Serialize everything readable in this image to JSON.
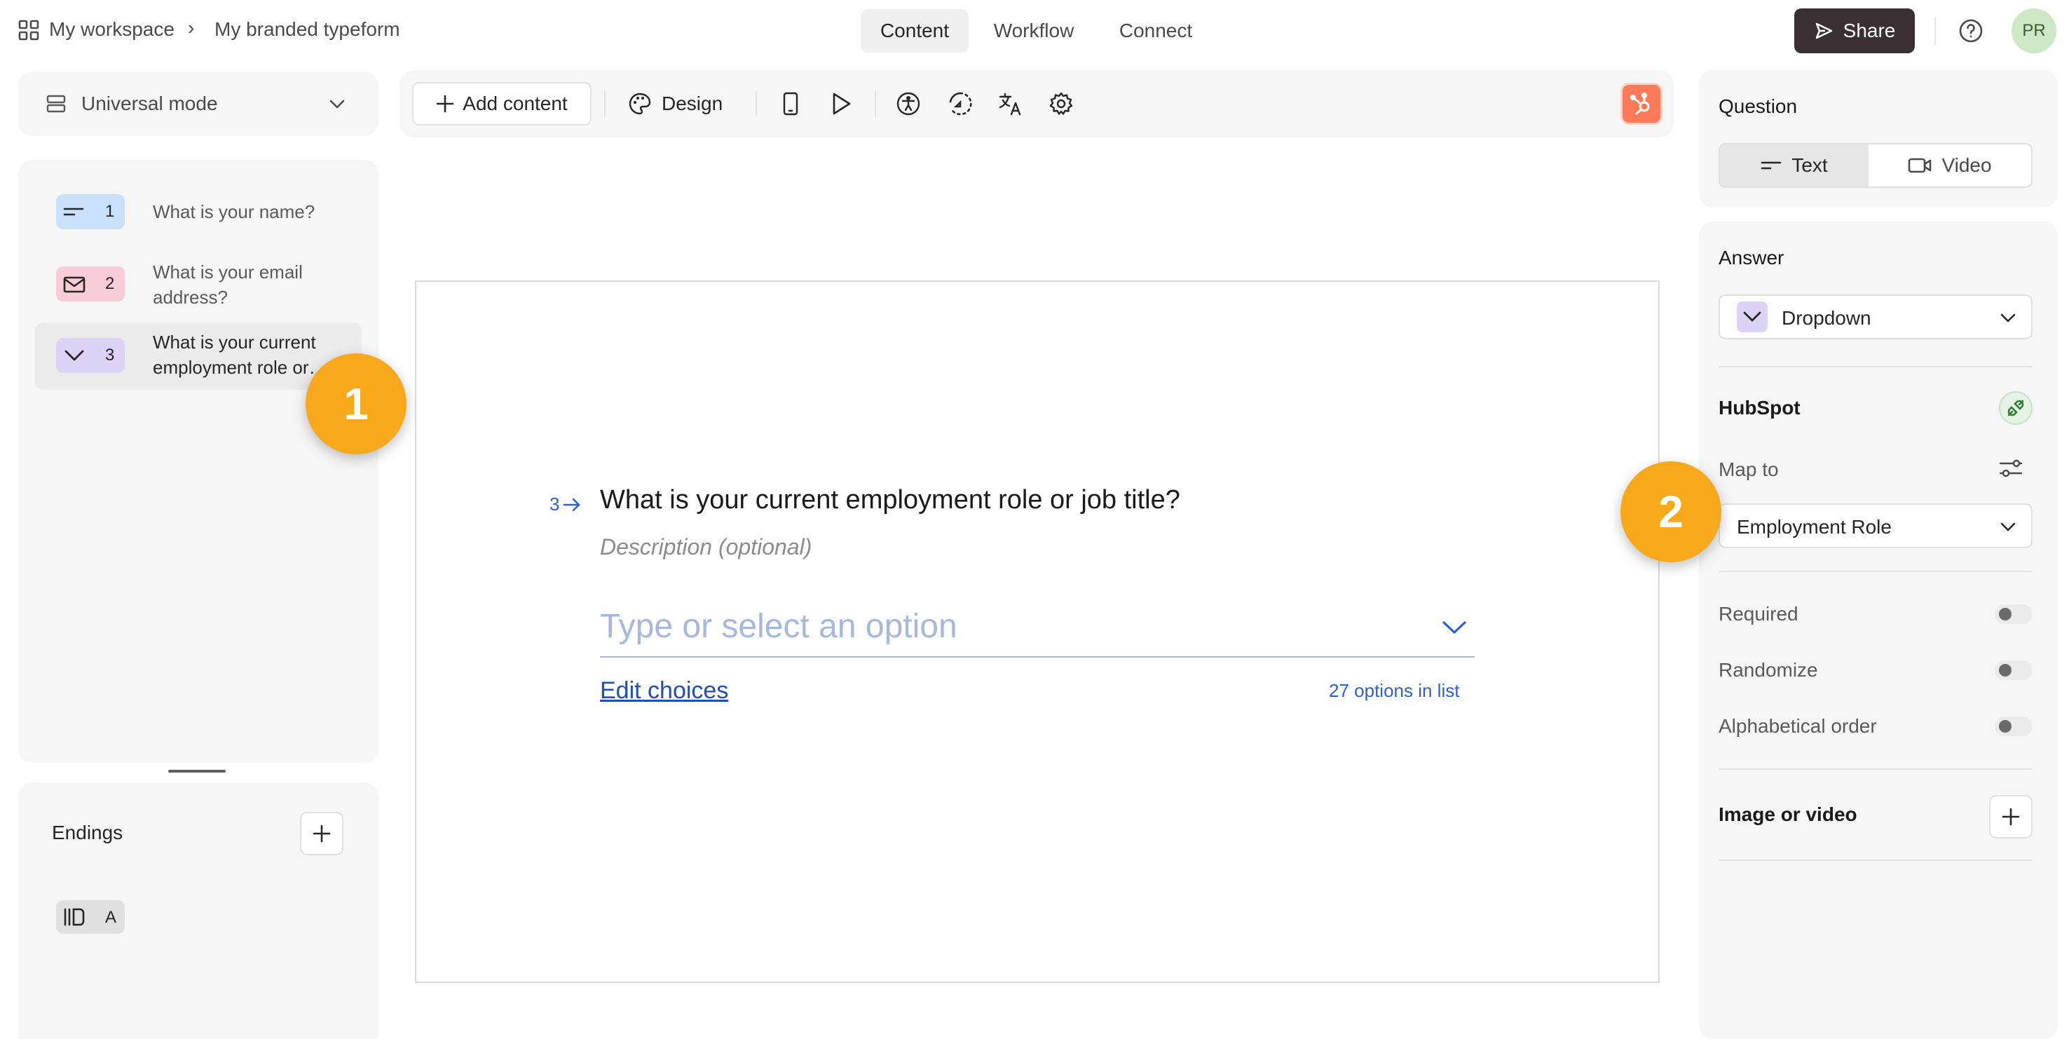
{
  "breadcrumb": {
    "workspace": "My workspace",
    "separator": "›",
    "form_name": "My branded typeform"
  },
  "nav": {
    "tabs": [
      {
        "label": "Content",
        "active": true
      },
      {
        "label": "Workflow"
      },
      {
        "label": "Connect"
      }
    ]
  },
  "topbar": {
    "share_label": "Share",
    "avatar_initials": "PR"
  },
  "sidebar": {
    "mode_label": "Universal mode",
    "questions": [
      {
        "number": "1",
        "text": "What is your name?",
        "type_icon": "short-text-icon",
        "badge_color": "#c9e0fb"
      },
      {
        "number": "2",
        "text": "What is your email address?",
        "type_icon": "mail-icon",
        "badge_color": "#f9cdd8"
      },
      {
        "number": "3",
        "text": "What is your current employment role or…",
        "type_icon": "chevron-down-icon",
        "badge_color": "#ddd3f6",
        "active": true
      }
    ],
    "endings_label": "Endings",
    "endings": [
      {
        "label": "A",
        "icon": "ending-icon"
      }
    ]
  },
  "toolbar": {
    "add_content_label": "Add content",
    "design_label": "Design"
  },
  "canvas": {
    "question_number": "3",
    "question_title": "What is your current employment role or job title?",
    "description_placeholder": "Description (optional)",
    "dropdown_placeholder": "Type or select an option",
    "edit_choices_label": "Edit choices",
    "options_count": "27 options in list"
  },
  "markers": {
    "first": "1",
    "second": "2"
  },
  "settings": {
    "question_heading": "Question",
    "question_format": [
      {
        "label": "Text",
        "active": true
      },
      {
        "label": "Video"
      }
    ],
    "answer_heading": "Answer",
    "answer_type": "Dropdown",
    "hubspot_heading": "HubSpot",
    "map_to_label": "Map to",
    "map_to_value": "Employment Role",
    "toggles": [
      {
        "label": "Required",
        "on": false
      },
      {
        "label": "Randomize",
        "on": false
      },
      {
        "label": "Alphabetical order",
        "on": false
      }
    ],
    "media_label": "Image or video"
  },
  "colors": {
    "accent_blue": "#2f5fd0",
    "marker": "#f8a81b",
    "share_button": "#3a3033",
    "hubspot": "#ff7a59"
  }
}
